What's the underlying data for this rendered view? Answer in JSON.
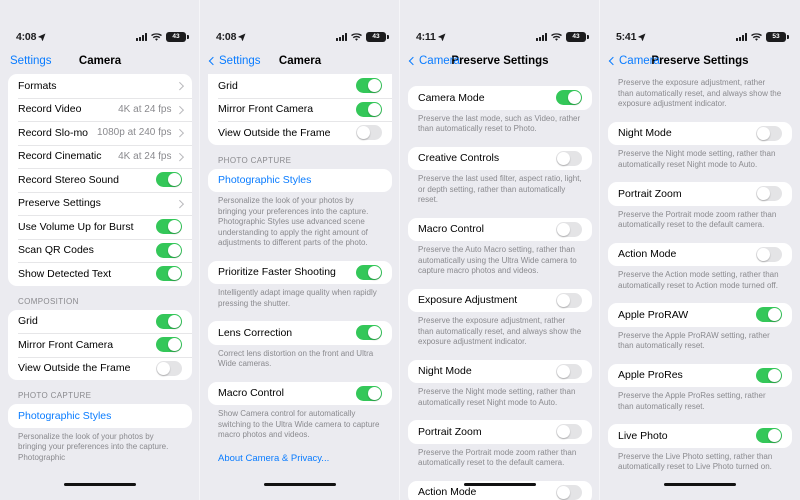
{
  "colors": {
    "accent_blue": "#0a7cff",
    "toggle_on_green": "#34c759",
    "toggle_off_gray": "#e4e4e6",
    "page_background": "#ebebf0",
    "card_white": "#ffffff",
    "secondary_text": "#8a8a8e"
  },
  "panels": [
    {
      "id": "camera-settings-top",
      "status": {
        "time": "4:08",
        "battery_level": "43"
      },
      "nav": {
        "back_label": "Settings",
        "title": "Camera",
        "has_back_chevron": false
      },
      "groups": [
        {
          "type": "list",
          "rows": [
            {
              "label": "Formats",
              "value": "",
              "control": "chevron"
            },
            {
              "label": "Record Video",
              "value": "4K at 24 fps",
              "control": "chevron"
            },
            {
              "label": "Record Slo-mo",
              "value": "1080p at 240 fps",
              "control": "chevron"
            },
            {
              "label": "Record Cinematic",
              "value": "4K at 24 fps",
              "control": "chevron"
            },
            {
              "label": "Record Stereo Sound",
              "value": "",
              "control": "toggle-on"
            },
            {
              "label": "Preserve Settings",
              "value": "",
              "control": "chevron"
            },
            {
              "label": "Use Volume Up for Burst",
              "value": "",
              "control": "toggle-on"
            },
            {
              "label": "Scan QR Codes",
              "value": "",
              "control": "toggle-on"
            },
            {
              "label": "Show Detected Text",
              "value": "",
              "control": "toggle-on"
            }
          ]
        },
        {
          "type": "header",
          "text": "COMPOSITION"
        },
        {
          "type": "list",
          "rows": [
            {
              "label": "Grid",
              "value": "",
              "control": "toggle-on"
            },
            {
              "label": "Mirror Front Camera",
              "value": "",
              "control": "toggle-on"
            },
            {
              "label": "View Outside the Frame",
              "value": "",
              "control": "toggle-off"
            }
          ]
        },
        {
          "type": "header",
          "text": "PHOTO CAPTURE"
        },
        {
          "type": "list",
          "rows": [
            {
              "label": "Photographic Styles",
              "value": "",
              "control": "none",
              "blue": true
            }
          ]
        },
        {
          "type": "footnote",
          "text": "Personalize the look of your photos by bringing your preferences into the capture. Photographic"
        }
      ]
    },
    {
      "id": "camera-settings-bottom",
      "status": {
        "time": "4:08",
        "battery_level": "43"
      },
      "nav": {
        "back_label": "Settings",
        "title": "Camera",
        "has_back_chevron": true
      },
      "groups": [
        {
          "type": "list",
          "clip_top": true,
          "rows": [
            {
              "label": "Grid",
              "value": "",
              "control": "toggle-on"
            },
            {
              "label": "Mirror Front Camera",
              "value": "",
              "control": "toggle-on"
            },
            {
              "label": "View Outside the Frame",
              "value": "",
              "control": "toggle-off"
            }
          ]
        },
        {
          "type": "header",
          "text": "PHOTO CAPTURE"
        },
        {
          "type": "list",
          "rows": [
            {
              "label": "Photographic Styles",
              "value": "",
              "control": "none",
              "blue": true
            }
          ]
        },
        {
          "type": "footnote",
          "text": "Personalize the look of your photos by bringing your preferences into the capture. Photographic Styles use advanced scene understanding to apply the right amount of adjustments to different parts of the photo."
        },
        {
          "type": "spacer"
        },
        {
          "type": "list",
          "rows": [
            {
              "label": "Prioritize Faster Shooting",
              "value": "",
              "control": "toggle-on"
            }
          ]
        },
        {
          "type": "footnote",
          "text": "Intelligently adapt image quality when rapidly pressing the shutter."
        },
        {
          "type": "spacer"
        },
        {
          "type": "list",
          "rows": [
            {
              "label": "Lens Correction",
              "value": "",
              "control": "toggle-on"
            }
          ]
        },
        {
          "type": "footnote",
          "text": "Correct lens distortion on the front and Ultra Wide cameras."
        },
        {
          "type": "spacer"
        },
        {
          "type": "list",
          "rows": [
            {
              "label": "Macro Control",
              "value": "",
              "control": "toggle-on"
            }
          ]
        },
        {
          "type": "footnote",
          "text": "Show Camera control for automatically switching to the Ultra Wide camera to capture macro photos and videos."
        },
        {
          "type": "link",
          "text": "About Camera & Privacy..."
        }
      ]
    },
    {
      "id": "preserve-settings-top",
      "status": {
        "time": "4:11",
        "battery_level": "43"
      },
      "nav": {
        "back_label": "Camera",
        "title": "Preserve Settings",
        "has_back_chevron": true
      },
      "groups": [
        {
          "type": "spacer"
        },
        {
          "type": "list",
          "rows": [
            {
              "label": "Camera Mode",
              "value": "",
              "control": "toggle-on"
            }
          ]
        },
        {
          "type": "footnote",
          "text": "Preserve the last mode, such as Video, rather than automatically reset to Photo."
        },
        {
          "type": "spacer"
        },
        {
          "type": "list",
          "rows": [
            {
              "label": "Creative Controls",
              "value": "",
              "control": "toggle-off"
            }
          ]
        },
        {
          "type": "footnote",
          "text": "Preserve the last used filter, aspect ratio, light, or depth setting, rather than automatically reset."
        },
        {
          "type": "spacer"
        },
        {
          "type": "list",
          "rows": [
            {
              "label": "Macro Control",
              "value": "",
              "control": "toggle-off"
            }
          ]
        },
        {
          "type": "footnote",
          "text": "Preserve the Auto Macro setting, rather than automatically using the Ultra Wide camera to capture macro photos and videos."
        },
        {
          "type": "spacer"
        },
        {
          "type": "list",
          "rows": [
            {
              "label": "Exposure Adjustment",
              "value": "",
              "control": "toggle-off"
            }
          ]
        },
        {
          "type": "footnote",
          "text": "Preserve the exposure adjustment, rather than automatically reset, and always show the exposure adjustment indicator."
        },
        {
          "type": "spacer"
        },
        {
          "type": "list",
          "rows": [
            {
              "label": "Night Mode",
              "value": "",
              "control": "toggle-off"
            }
          ]
        },
        {
          "type": "footnote",
          "text": "Preserve the Night mode setting, rather than automatically reset Night mode to Auto."
        },
        {
          "type": "spacer"
        },
        {
          "type": "list",
          "rows": [
            {
              "label": "Portrait Zoom",
              "value": "",
              "control": "toggle-off"
            }
          ]
        },
        {
          "type": "footnote",
          "text": "Preserve the Portrait mode zoom rather than automatically reset to the default camera."
        },
        {
          "type": "spacer"
        },
        {
          "type": "list",
          "rows": [
            {
              "label": "Action Mode",
              "value": "",
              "control": "toggle-off"
            }
          ]
        }
      ]
    },
    {
      "id": "preserve-settings-bottom",
      "status": {
        "time": "5:41",
        "battery_level": "53"
      },
      "nav": {
        "back_label": "Camera",
        "title": "Preserve Settings",
        "has_back_chevron": true
      },
      "groups": [
        {
          "type": "footnote",
          "text": "Preserve the exposure adjustment, rather than automatically reset, and always show the exposure adjustment indicator."
        },
        {
          "type": "spacer"
        },
        {
          "type": "list",
          "rows": [
            {
              "label": "Night Mode",
              "value": "",
              "control": "toggle-off"
            }
          ]
        },
        {
          "type": "footnote",
          "text": "Preserve the Night mode setting, rather than automatically reset Night mode to Auto."
        },
        {
          "type": "spacer"
        },
        {
          "type": "list",
          "rows": [
            {
              "label": "Portrait Zoom",
              "value": "",
              "control": "toggle-off"
            }
          ]
        },
        {
          "type": "footnote",
          "text": "Preserve the Portrait mode zoom rather than automatically reset to the default camera."
        },
        {
          "type": "spacer"
        },
        {
          "type": "list",
          "rows": [
            {
              "label": "Action Mode",
              "value": "",
              "control": "toggle-off"
            }
          ]
        },
        {
          "type": "footnote",
          "text": "Preserve the Action mode setting, rather than automatically reset to Action mode turned off."
        },
        {
          "type": "spacer"
        },
        {
          "type": "list",
          "rows": [
            {
              "label": "Apple ProRAW",
              "value": "",
              "control": "toggle-on"
            }
          ]
        },
        {
          "type": "footnote",
          "text": "Preserve the Apple ProRAW setting, rather than automatically reset."
        },
        {
          "type": "spacer"
        },
        {
          "type": "list",
          "rows": [
            {
              "label": "Apple ProRes",
              "value": "",
              "control": "toggle-on"
            }
          ]
        },
        {
          "type": "footnote",
          "text": "Preserve the Apple ProRes setting, rather than automatically reset."
        },
        {
          "type": "spacer"
        },
        {
          "type": "list",
          "rows": [
            {
              "label": "Live Photo",
              "value": "",
              "control": "toggle-on"
            }
          ]
        },
        {
          "type": "footnote",
          "text": "Preserve the Live Photo setting, rather than automatically reset to Live Photo turned on."
        }
      ]
    }
  ]
}
